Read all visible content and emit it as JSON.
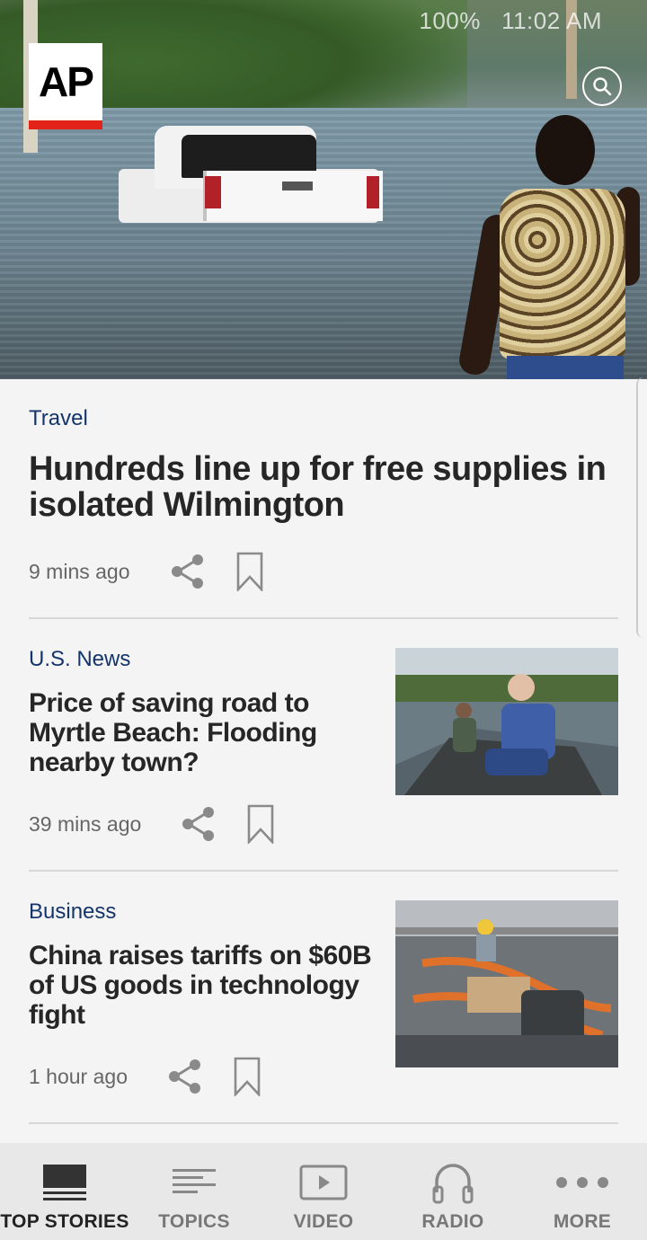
{
  "status_bar": {
    "battery": "100%",
    "time": "11:02 AM"
  },
  "brand": {
    "logo_text": "AP",
    "accent": "#e2231a"
  },
  "search": {
    "icon": "search-icon"
  },
  "articles": [
    {
      "category": "Travel",
      "title": "Hundreds line up for free supplies in isolated Wilmington",
      "time": "9 mins ago"
    },
    {
      "category": "U.S. News",
      "title": "Price of saving road to Myrtle Beach: Flooding nearby town?",
      "time": "39 mins ago"
    },
    {
      "category": "Business",
      "title": "China raises tariffs on $60B of US goods in technology fight",
      "time": "1 hour ago"
    }
  ],
  "nav": [
    {
      "label": "TOP STORIES",
      "icon": "top-stories-icon",
      "active": true
    },
    {
      "label": "TOPICS",
      "icon": "topics-icon",
      "active": false
    },
    {
      "label": "VIDEO",
      "icon": "video-icon",
      "active": false
    },
    {
      "label": "RADIO",
      "icon": "radio-icon",
      "active": false
    },
    {
      "label": "MORE",
      "icon": "more-icon",
      "active": false
    }
  ],
  "colors": {
    "category": "#14356b",
    "headline": "#262626",
    "meta": "#666666",
    "background": "#f4f4f4"
  }
}
